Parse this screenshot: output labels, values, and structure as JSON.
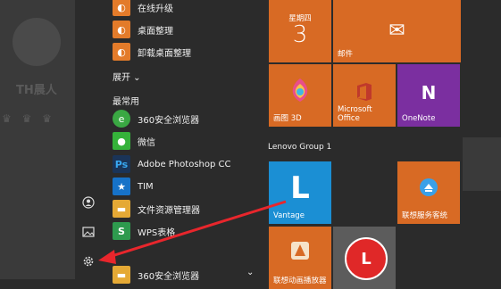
{
  "profile": {
    "name": "TH晨人",
    "crowns": "♛ ♛ ♛"
  },
  "rail": {
    "user_icon": "user-icon",
    "pictures_icon": "pictures-icon",
    "settings_icon": "gear-icon"
  },
  "apps": {
    "top_items": [
      {
        "label": "在线升级",
        "color": "#e37b2a",
        "icon": "update-icon"
      },
      {
        "label": "桌面整理",
        "color": "#e37b2a",
        "icon": "desktop-organizer-icon"
      },
      {
        "label": "卸载桌面整理",
        "color": "#e37b2a",
        "icon": "uninstall-icon"
      }
    ],
    "expand_label": "展开 ⌄",
    "frequent_label": "最常用",
    "frequent_items": [
      {
        "label": "360安全浏览器",
        "color": "#3aa843",
        "icon": "browser-icon"
      },
      {
        "label": "微信",
        "color": "#35b23a",
        "icon": "wechat-icon"
      },
      {
        "label": "Adobe Photoshop CC",
        "color": "#1a3458",
        "icon": "photoshop-icon",
        "glyph": "Ps"
      },
      {
        "label": "TIM",
        "color": "#1672c8",
        "icon": "tim-icon",
        "glyph": "★"
      },
      {
        "label": "文件资源管理器",
        "color": "#e5a935",
        "icon": "folder-icon"
      },
      {
        "label": "WPS表格",
        "color": "#2e9a4e",
        "icon": "wps-sheet-icon",
        "glyph": "S"
      },
      {
        "label": "360安全浏览器",
        "color": "#e5a935",
        "icon": "browser-folder-icon"
      }
    ]
  },
  "tiles": {
    "calendar": {
      "day_label": "星期四",
      "date": "3"
    },
    "mail": {
      "label": "邮件"
    },
    "paint3d": {
      "label": "画图 3D"
    },
    "office": {
      "label": "Microsoft Office"
    },
    "onenote": {
      "label": "OneNote"
    },
    "group_title": "Lenovo Group 1",
    "vantage": {
      "label": "Vantage"
    },
    "lenovo_service": {
      "label": "联想服务客统"
    },
    "bottom_left": {
      "label": "联想动画播放器"
    },
    "bottom_right": {
      "label": "L"
    }
  },
  "colors": {
    "tile_orange": "#d86a24",
    "tile_purple": "#7b2fa0",
    "tile_blue": "#1b8fd4",
    "tile_gray": "#5c5c5c",
    "arrow_red": "#e8262c"
  }
}
